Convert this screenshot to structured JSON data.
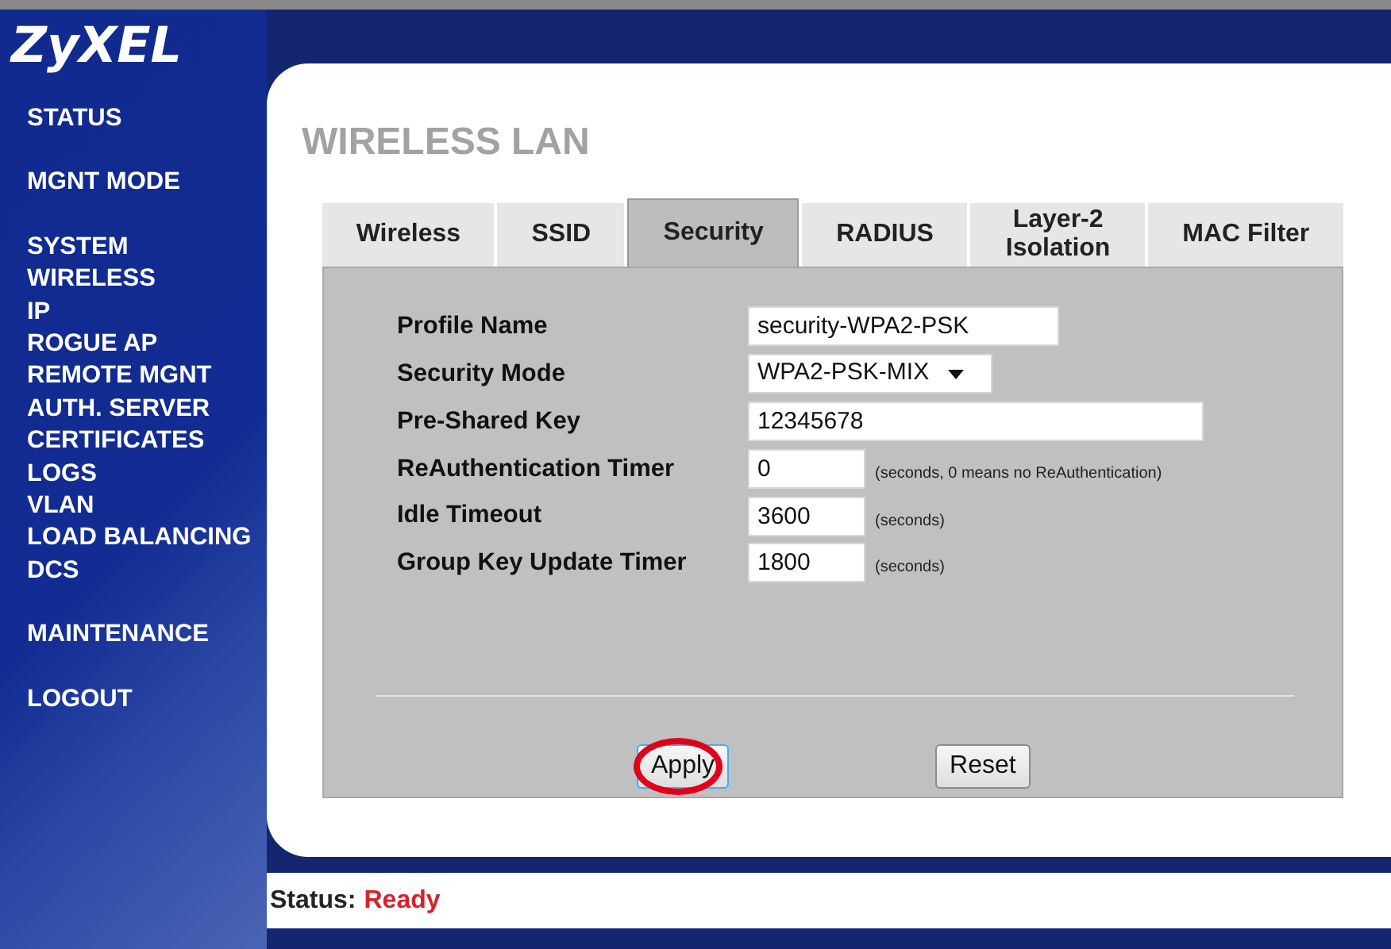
{
  "logo": "ZyXEL",
  "sidebar": {
    "groups": [
      [
        {
          "label": "STATUS"
        }
      ],
      [
        {
          "label": "MGNT MODE"
        }
      ],
      [
        {
          "label": "SYSTEM"
        },
        {
          "label": "WIRELESS"
        },
        {
          "label": "IP"
        },
        {
          "label": "ROGUE AP"
        },
        {
          "label": "REMOTE MGNT"
        },
        {
          "label": "AUTH. SERVER"
        },
        {
          "label": "CERTIFICATES"
        },
        {
          "label": "LOGS"
        },
        {
          "label": "VLAN"
        },
        {
          "label": "LOAD BALANCING"
        },
        {
          "label": "DCS"
        }
      ],
      [
        {
          "label": "MAINTENANCE"
        }
      ],
      [
        {
          "label": "LOGOUT"
        }
      ]
    ]
  },
  "page_title": "WIRELESS LAN",
  "tabs": [
    {
      "label": "Wireless",
      "selected": false
    },
    {
      "label": "SSID",
      "selected": false
    },
    {
      "label": "Security",
      "selected": true
    },
    {
      "label": "RADIUS",
      "selected": false
    },
    {
      "label": "Layer-2 Isolation",
      "selected": false
    },
    {
      "label": "MAC Filter",
      "selected": false
    }
  ],
  "fields": [
    {
      "label": "Profile Name",
      "kind": "text",
      "value": "security-WPA2-PSK"
    },
    {
      "label": "Security Mode",
      "kind": "select",
      "value": "WPA2-PSK-MIX"
    },
    {
      "label": "Pre-Shared Key",
      "kind": "key",
      "value": "12345678"
    },
    {
      "label": "ReAuthentication Timer",
      "kind": "number",
      "value": "0",
      "hint": "(seconds, 0 means no ReAuthentication)"
    },
    {
      "label": "Idle Timeout",
      "kind": "number",
      "value": "3600",
      "hint": "(seconds)"
    },
    {
      "label": "Group Key Update Timer",
      "kind": "number",
      "value": "1800",
      "hint": "(seconds)"
    }
  ],
  "buttons": [
    {
      "label": "Apply",
      "highlighted": true
    },
    {
      "label": "Reset",
      "highlighted": false
    }
  ],
  "status_bar": {
    "label": "Status:",
    "value": "Ready"
  }
}
